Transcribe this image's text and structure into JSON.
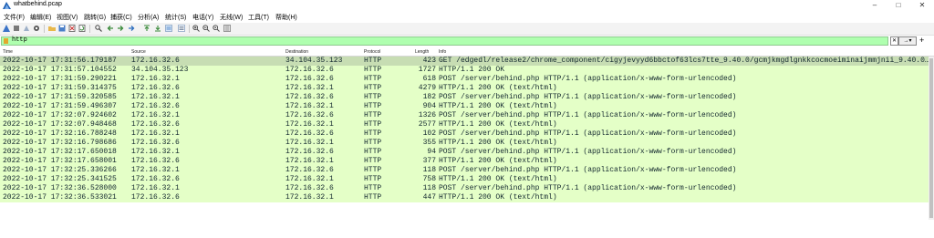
{
  "window": {
    "title": "whatbehind.pcap"
  },
  "menu": [
    "文件(F)",
    "编辑(E)",
    "视图(V)",
    "跳转(G)",
    "捕获(C)",
    "分析(A)",
    "统计(S)",
    "电话(Y)",
    "无线(W)",
    "工具(T)",
    "帮助(H)"
  ],
  "toolbar": {
    "icons": [
      "shark-fin-start-icon",
      "stop-icon",
      "restart-icon",
      "options-gear-icon",
      "open-folder-icon",
      "save-icon",
      "close-file-icon",
      "reload-icon",
      "find-icon",
      "back-arrow-icon",
      "forward-arrow-icon",
      "go-to-packet-icon",
      "first-packet-icon",
      "last-packet-icon",
      "autoscroll-icon",
      "colorize-icon",
      "zoom-in-icon",
      "zoom-out-icon",
      "zoom-reset-icon",
      "resize-columns-icon"
    ]
  },
  "filter": {
    "value": "http"
  },
  "columns": {
    "time": "Time",
    "source": "Source",
    "destination": "Destination",
    "protocol": "Protocol",
    "length": "Length",
    "info": "Info"
  },
  "packets": [
    {
      "time": "2022-10-17 17:31:56.179187",
      "source": "172.16.32.6",
      "destination": "34.104.35.123",
      "protocol": "HTTP",
      "length": "423",
      "info": "GET /edgedl/release2/chrome_component/cigyjevyyd6bbctof63lcs7tte_9.40.0/gcmjkmgdlgnkkcocmoeiminaijmmjnii_9.40.0…"
    },
    {
      "time": "2022-10-17 17:31:57.104552",
      "source": "34.104.35.123",
      "destination": "172.16.32.6",
      "protocol": "HTTP",
      "length": "1727",
      "info": "HTTP/1.1 200 OK"
    },
    {
      "time": "2022-10-17 17:31:59.290221",
      "source": "172.16.32.1",
      "destination": "172.16.32.6",
      "protocol": "HTTP",
      "length": "618",
      "info": "POST /server/behind.php HTTP/1.1  (application/x-www-form-urlencoded)"
    },
    {
      "time": "2022-10-17 17:31:59.314375",
      "source": "172.16.32.6",
      "destination": "172.16.32.1",
      "protocol": "HTTP",
      "length": "4279",
      "info": "HTTP/1.1 200 OK  (text/html)"
    },
    {
      "time": "2022-10-17 17:31:59.320585",
      "source": "172.16.32.1",
      "destination": "172.16.32.6",
      "protocol": "HTTP",
      "length": "182",
      "info": "POST /server/behind.php HTTP/1.1  (application/x-www-form-urlencoded)"
    },
    {
      "time": "2022-10-17 17:31:59.496307",
      "source": "172.16.32.6",
      "destination": "172.16.32.1",
      "protocol": "HTTP",
      "length": "904",
      "info": "HTTP/1.1 200 OK  (text/html)"
    },
    {
      "time": "2022-10-17 17:32:07.924602",
      "source": "172.16.32.1",
      "destination": "172.16.32.6",
      "protocol": "HTTP",
      "length": "1326",
      "info": "POST /server/behind.php HTTP/1.1  (application/x-www-form-urlencoded)"
    },
    {
      "time": "2022-10-17 17:32:07.948468",
      "source": "172.16.32.6",
      "destination": "172.16.32.1",
      "protocol": "HTTP",
      "length": "2577",
      "info": "HTTP/1.1 200 OK  (text/html)"
    },
    {
      "time": "2022-10-17 17:32:16.788248",
      "source": "172.16.32.1",
      "destination": "172.16.32.6",
      "protocol": "HTTP",
      "length": "102",
      "info": "POST /server/behind.php HTTP/1.1  (application/x-www-form-urlencoded)"
    },
    {
      "time": "2022-10-17 17:32:16.798686",
      "source": "172.16.32.6",
      "destination": "172.16.32.1",
      "protocol": "HTTP",
      "length": "355",
      "info": "HTTP/1.1 200 OK  (text/html)"
    },
    {
      "time": "2022-10-17 17:32:17.650018",
      "source": "172.16.32.1",
      "destination": "172.16.32.6",
      "protocol": "HTTP",
      "length": "94",
      "info": "POST /server/behind.php HTTP/1.1  (application/x-www-form-urlencoded)"
    },
    {
      "time": "2022-10-17 17:32:17.658001",
      "source": "172.16.32.6",
      "destination": "172.16.32.1",
      "protocol": "HTTP",
      "length": "377",
      "info": "HTTP/1.1 200 OK  (text/html)"
    },
    {
      "time": "2022-10-17 17:32:25.336266",
      "source": "172.16.32.1",
      "destination": "172.16.32.6",
      "protocol": "HTTP",
      "length": "118",
      "info": "POST /server/behind.php HTTP/1.1  (application/x-www-form-urlencoded)"
    },
    {
      "time": "2022-10-17 17:32:25.341525",
      "source": "172.16.32.6",
      "destination": "172.16.32.1",
      "protocol": "HTTP",
      "length": "758",
      "info": "HTTP/1.1 200 OK  (text/html)"
    },
    {
      "time": "2022-10-17 17:32:36.528000",
      "source": "172.16.32.1",
      "destination": "172.16.32.6",
      "protocol": "HTTP",
      "length": "118",
      "info": "POST /server/behind.php HTTP/1.1  (application/x-www-form-urlencoded)"
    },
    {
      "time": "2022-10-17 17:32:36.533021",
      "source": "172.16.32.6",
      "destination": "172.16.32.1",
      "protocol": "HTTP",
      "length": "447",
      "info": "HTTP/1.1 200 OK  (text/html)"
    }
  ],
  "selected_row": 0,
  "colors": {
    "row_bg": "#e4ffc7",
    "row_selected_bg": "#c7ddb3",
    "filter_ok_bg": "#afffaf"
  }
}
